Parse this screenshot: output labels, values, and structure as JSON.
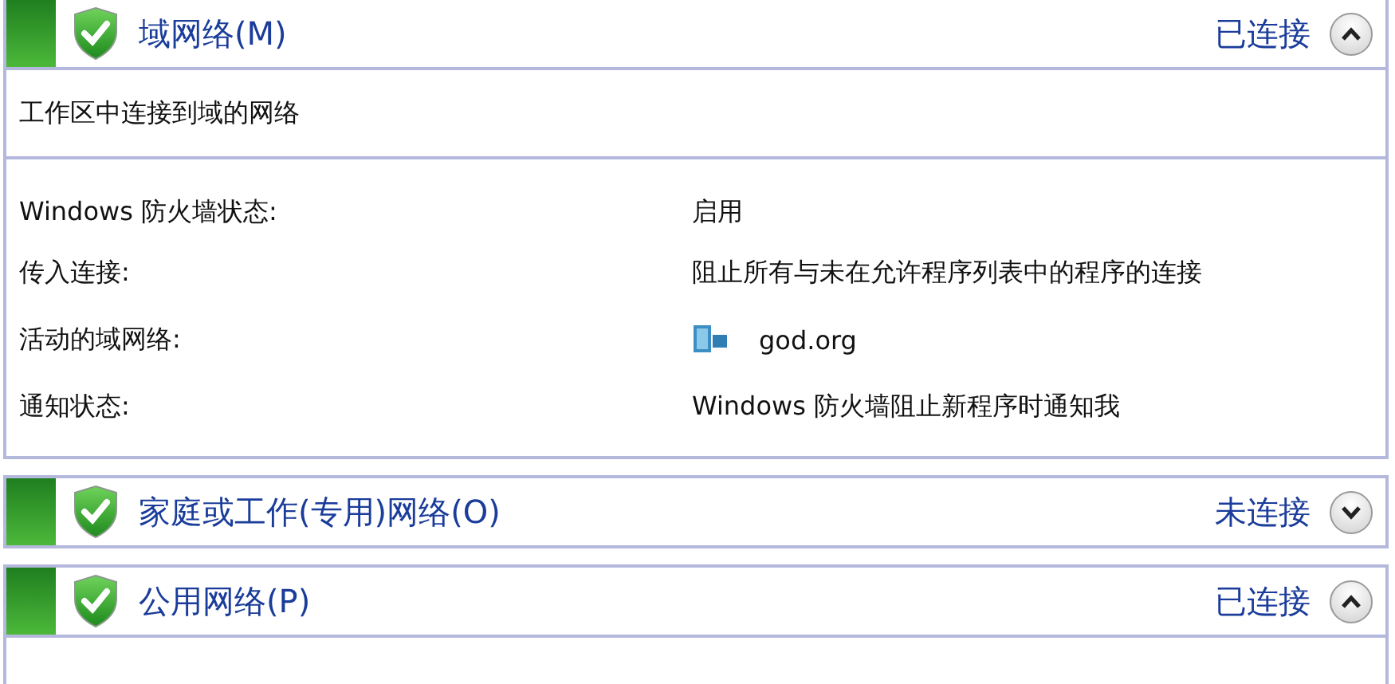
{
  "networks": [
    {
      "title": "域网络(M)",
      "status": "已连接",
      "expanded": true,
      "description": "工作区中连接到域的网络",
      "details": [
        {
          "label": "Windows 防火墙状态:",
          "value": "启用"
        },
        {
          "label": "传入连接:",
          "value": "阻止所有与未在允许程序列表中的程序的连接"
        },
        {
          "label": "活动的域网络:",
          "value": "god.org",
          "kind": "network"
        },
        {
          "label": "通知状态:",
          "value": "Windows 防火墙阻止新程序时通知我"
        }
      ]
    },
    {
      "title": "家庭或工作(专用)网络(O)",
      "status": "未连接",
      "expanded": false
    },
    {
      "title": "公用网络(P)",
      "status": "已连接",
      "expanded": true
    }
  ]
}
